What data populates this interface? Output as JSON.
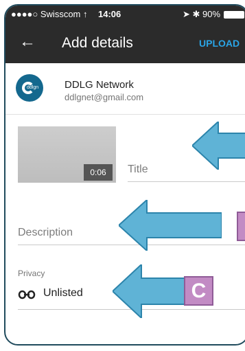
{
  "status_bar": {
    "carrier": "●●●●○ Swisscom ↑",
    "time": "14:06",
    "right_status": "➤ ✱ 90%"
  },
  "app_bar": {
    "back_icon": "arrow-back",
    "title": "Add details",
    "upload_label": "UPLOAD"
  },
  "account": {
    "name": "DDLG Network",
    "email": "ddlgnet@gmail.com",
    "avatar_text": "ddlgn"
  },
  "video": {
    "duration": "0:06"
  },
  "form": {
    "title_placeholder": "Title",
    "description_placeholder": "Description",
    "privacy_label": "Privacy",
    "privacy_value": "Unlisted",
    "privacy_icon": "link-icon"
  },
  "annotations": {
    "marker_c": "C"
  },
  "colors": {
    "header_bg": "#2b2b2b",
    "upload": "#2aa4e6",
    "arrow": "#5fb3d6",
    "marker": "#c28bc4"
  }
}
